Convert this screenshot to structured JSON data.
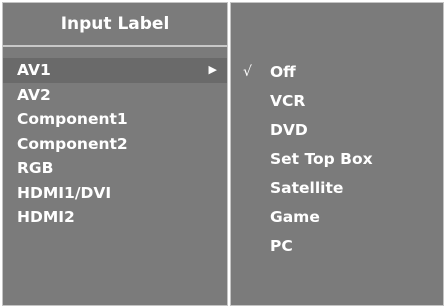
{
  "colors": {
    "panel_bg": "#7b7b7b",
    "panel_border": "#c4c4c4",
    "highlight_bg": "#6a6a6a",
    "text": "#ffffff"
  },
  "input_menu": {
    "title": "Input Label",
    "items": [
      {
        "label": "AV1",
        "selected": true,
        "has_submenu": true
      },
      {
        "label": "AV2"
      },
      {
        "label": "Component1"
      },
      {
        "label": "Component2"
      },
      {
        "label": "RGB"
      },
      {
        "label": "HDMI1/DVI"
      },
      {
        "label": "HDMI2"
      }
    ],
    "submenu_arrow": "▶"
  },
  "label_options": {
    "check_mark": "√",
    "checked_index": 0,
    "items": [
      {
        "label": "Off"
      },
      {
        "label": "VCR"
      },
      {
        "label": "DVD"
      },
      {
        "label": "Set Top Box"
      },
      {
        "label": "Satellite"
      },
      {
        "label": "Game"
      },
      {
        "label": "PC"
      }
    ]
  }
}
